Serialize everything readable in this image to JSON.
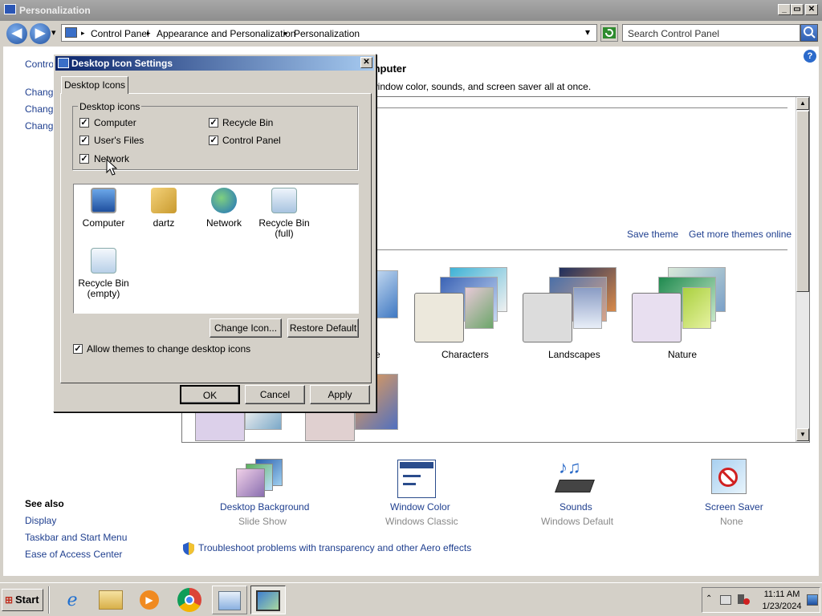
{
  "window": {
    "title": "Personalization",
    "btn_min": "_",
    "btn_max": "▭",
    "btn_close": "✕"
  },
  "nav": {
    "back_glyph": "◀",
    "fwd_glyph": "▶",
    "dropdown_glyph": "▾",
    "breadcrumbs": [
      "Control Panel",
      "Appearance and Personalization",
      "Personalization"
    ],
    "sep": "▸",
    "search_placeholder": "Search Control Panel",
    "help_glyph": "?"
  },
  "left": {
    "control_link": "Control",
    "changes": [
      "Change",
      "Change",
      "Change"
    ]
  },
  "main": {
    "heading": "mputer",
    "subtitle": "window color, sounds, and screen saver all at once.",
    "save_theme": "Save theme",
    "get_more": "Get more themes online",
    "partial_label": "e"
  },
  "themes": [
    {
      "label": "Characters"
    },
    {
      "label": "Landscapes"
    },
    {
      "label": "Nature"
    }
  ],
  "bottom": [
    {
      "label": "Desktop Background",
      "sub": "Slide Show",
      "icon": "desktop-background-icon"
    },
    {
      "label": "Window Color",
      "sub": "Windows Classic",
      "icon": "window-color-icon"
    },
    {
      "label": "Sounds",
      "sub": "Windows Default",
      "icon": "sounds-icon"
    },
    {
      "label": "Screen Saver",
      "sub": "None",
      "icon": "screen-saver-icon"
    }
  ],
  "troubleshoot": "Troubleshoot problems with transparency and other Aero effects",
  "see_also": {
    "title": "See also",
    "links": [
      "Display",
      "Taskbar and Start Menu",
      "Ease of Access Center"
    ]
  },
  "dialog": {
    "title": "Desktop Icon Settings",
    "close": "✕",
    "tab": "Desktop Icons",
    "group": "Desktop icons",
    "checks": [
      {
        "label": "Computer",
        "checked": true
      },
      {
        "label": "Recycle Bin",
        "checked": true
      },
      {
        "label": "User's Files",
        "checked": true
      },
      {
        "label": "Control Panel",
        "checked": true
      },
      {
        "label": "Network",
        "checked": true
      }
    ],
    "check_glyph": "✓",
    "icons": [
      {
        "label": "Computer",
        "icon": "computer-icon"
      },
      {
        "label": "dartz",
        "icon": "user-folder-icon"
      },
      {
        "label": "Network",
        "icon": "network-icon"
      },
      {
        "label": "Recycle Bin (full)",
        "icon": "recycle-bin-full-icon"
      },
      {
        "label": "Recycle Bin (empty)",
        "icon": "recycle-bin-empty-icon"
      }
    ],
    "change_icon": "Change Icon...",
    "restore_default": "Restore Default",
    "allow_themes": "Allow themes to change desktop icons",
    "ok": "OK",
    "cancel": "Cancel",
    "apply": "Apply"
  },
  "taskbar": {
    "start": "Start",
    "time": "11:11 AM",
    "date": "1/23/2024"
  },
  "colors": {
    "link": "#1f3f8f",
    "dialog_title_start": "#0a246a",
    "dialog_title_end": "#a6caf0",
    "chrome": "#d4d0c8"
  }
}
